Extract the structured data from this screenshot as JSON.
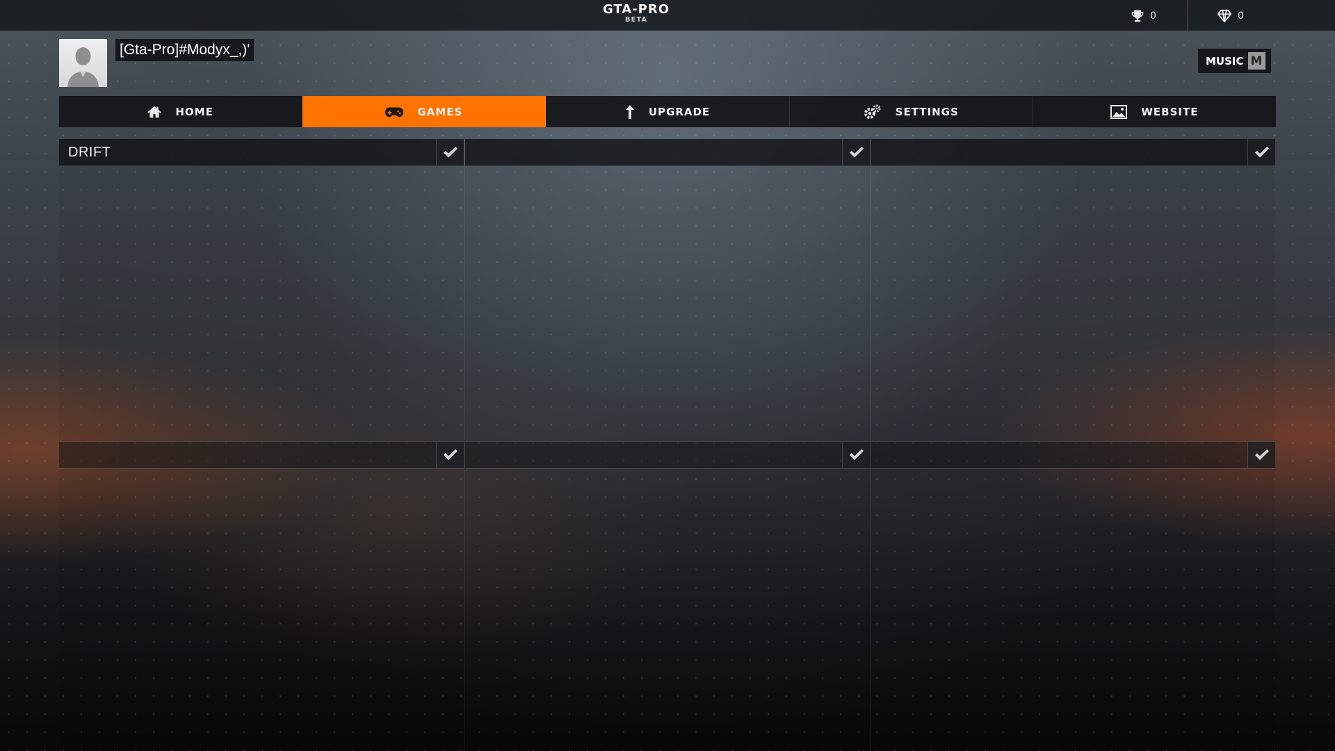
{
  "header": {
    "title": "GTA-PRO",
    "subtitle": "BETA",
    "trophy_count": "0",
    "gem_count": "0"
  },
  "profile": {
    "username": "[Gta-Pro]#Modyx_,)'"
  },
  "music": {
    "label": "MUSIC",
    "key": "M"
  },
  "nav": {
    "items": [
      {
        "label": "HOME",
        "icon": "home-icon"
      },
      {
        "label": "GAMES",
        "icon": "gamepad-icon",
        "active": true
      },
      {
        "label": "UPGRADE",
        "icon": "upgrade-arrow-icon"
      },
      {
        "label": "SETTINGS",
        "icon": "gears-icon"
      },
      {
        "label": "WEBSITE",
        "icon": "image-icon"
      }
    ]
  },
  "games": {
    "rows": [
      [
        "DRIFT",
        "",
        ""
      ],
      [
        "",
        "",
        ""
      ]
    ]
  },
  "colors": {
    "accent": "#ff7300",
    "bar": "#16191c"
  }
}
